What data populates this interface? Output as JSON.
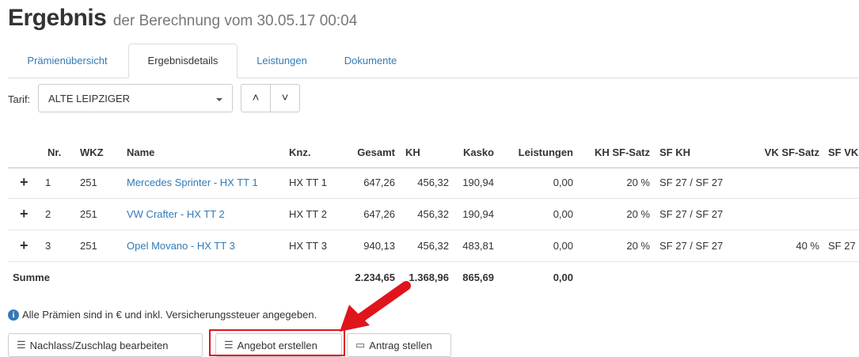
{
  "header": {
    "title": "Ergebnis",
    "subtitle": "der Berechnung vom 30.05.17 00:04"
  },
  "tabs": [
    {
      "label": "Prämienübersicht",
      "active": false
    },
    {
      "label": "Ergebnisdetails",
      "active": true
    },
    {
      "label": "Leistungen",
      "active": false
    },
    {
      "label": "Dokumente",
      "active": false
    }
  ],
  "tarif": {
    "label": "Tarif:",
    "selected": "ALTE LEIPZIGER"
  },
  "table": {
    "headers": [
      "",
      "Nr.",
      "WKZ",
      "Name",
      "Knz.",
      "Gesamt",
      "KH",
      "Kasko",
      "Leistungen",
      "KH SF-Satz",
      "SF KH",
      "VK SF-Satz",
      "SF VK"
    ],
    "rows": [
      {
        "expand": "+",
        "nr": "1",
        "wkz": "251",
        "name": "Mercedes Sprinter - HX TT 1",
        "knz": "HX TT 1",
        "gesamt": "647,26",
        "kh": "456,32",
        "kasko": "190,94",
        "leistungen": "0,00",
        "kh_sf_satz": "20 %",
        "sf_kh": "SF 27 / SF 27",
        "vk_sf_satz": "",
        "sf_vk": ""
      },
      {
        "expand": "+",
        "nr": "2",
        "wkz": "251",
        "name": "VW Crafter - HX TT 2",
        "knz": "HX TT 2",
        "gesamt": "647,26",
        "kh": "456,32",
        "kasko": "190,94",
        "leistungen": "0,00",
        "kh_sf_satz": "20 %",
        "sf_kh": "SF 27 / SF 27",
        "vk_sf_satz": "",
        "sf_vk": ""
      },
      {
        "expand": "+",
        "nr": "3",
        "wkz": "251",
        "name": "Opel Movano - HX TT 3",
        "knz": "HX TT 3",
        "gesamt": "940,13",
        "kh": "456,32",
        "kasko": "483,81",
        "leistungen": "0,00",
        "kh_sf_satz": "20 %",
        "sf_kh": "SF 27 / SF 27",
        "vk_sf_satz": "40 %",
        "sf_vk": "SF 27"
      }
    ],
    "summary": {
      "label": "Summe",
      "gesamt": "2.234,65",
      "kh": "1.368,96",
      "kasko": "865,69",
      "leistungen": "0,00"
    }
  },
  "note": {
    "text": "Alle Prämien sind in € und inkl. Versicherungssteuer angegeben."
  },
  "buttons": {
    "nachlass": "Nachlass/Zuschlag bearbeiten",
    "angebot": "Angebot erstellen",
    "antrag": "Antrag stellen"
  },
  "colors": {
    "link": "#337ab7",
    "highlight": "#e0141b"
  }
}
